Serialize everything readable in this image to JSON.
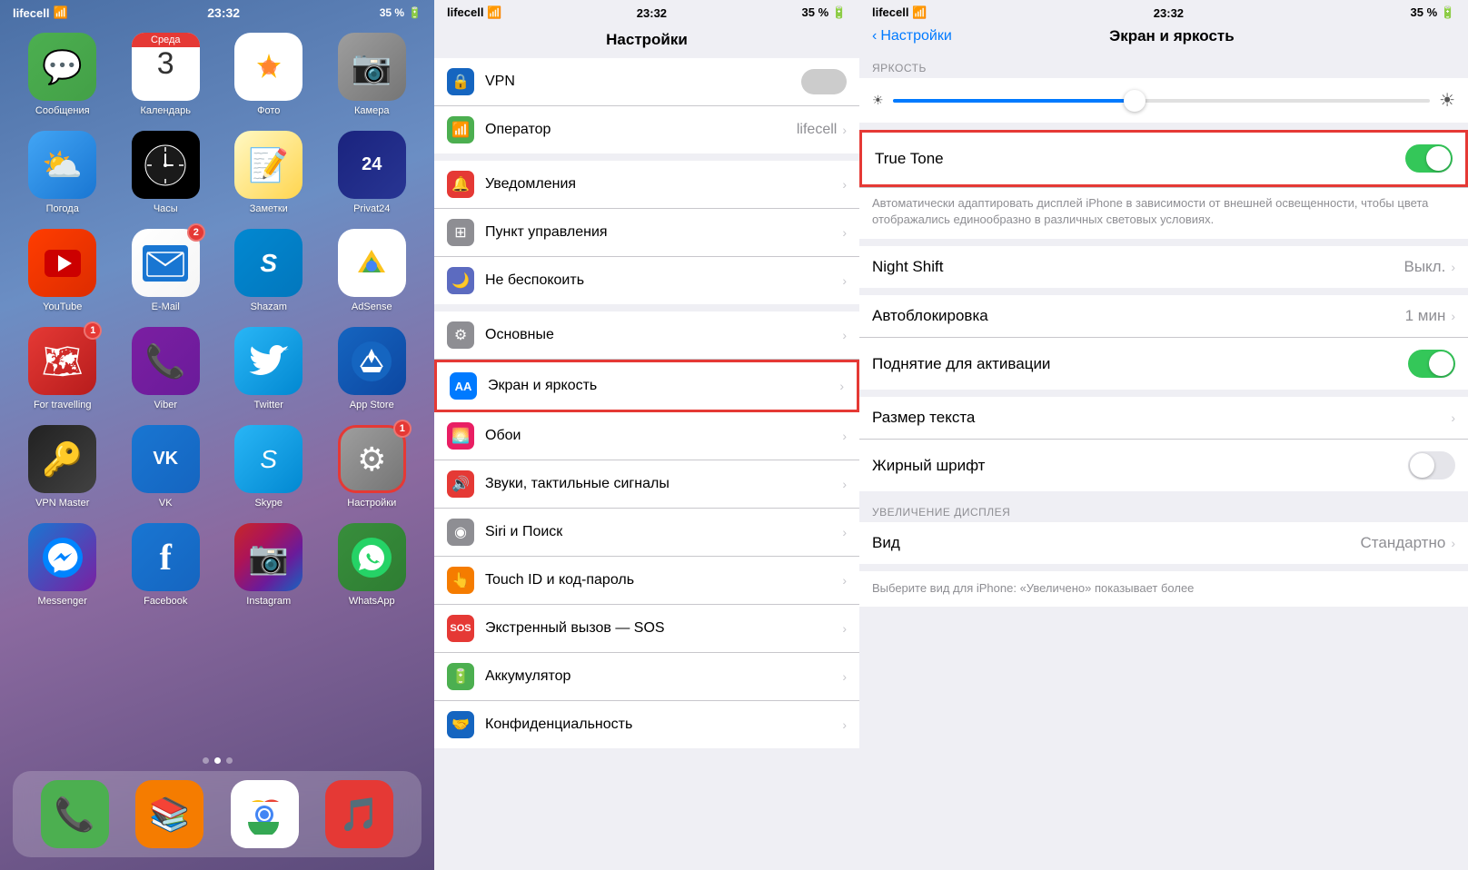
{
  "home": {
    "status": {
      "carrier": "lifecell",
      "time": "23:32",
      "battery": "35 %"
    },
    "apps": [
      {
        "id": "messages",
        "label": "Сообщения",
        "color": "app-messages",
        "icon": "💬",
        "badge": null
      },
      {
        "id": "calendar",
        "label": "Календарь",
        "color": "app-calendar",
        "icon": "calendar",
        "badge": null
      },
      {
        "id": "photos",
        "label": "Фото",
        "color": "app-photos",
        "icon": "photos",
        "badge": null
      },
      {
        "id": "camera",
        "label": "Камера",
        "color": "app-camera",
        "icon": "📷",
        "badge": null
      },
      {
        "id": "weather",
        "label": "Погода",
        "color": "app-weather",
        "icon": "⛅",
        "badge": null
      },
      {
        "id": "clock",
        "label": "Часы",
        "color": "app-clock",
        "icon": "clock",
        "badge": null
      },
      {
        "id": "notes",
        "label": "Заметки",
        "color": "app-notes",
        "icon": "📝",
        "badge": null
      },
      {
        "id": "privat24",
        "label": "Privat24",
        "color": "app-privat",
        "icon": "24",
        "badge": null
      },
      {
        "id": "youtube",
        "label": "YouTube",
        "color": "app-youtube",
        "icon": "▶",
        "badge": null
      },
      {
        "id": "email",
        "label": "E-Mail",
        "color": "app-email",
        "icon": "✉",
        "badge": "2"
      },
      {
        "id": "shazam",
        "label": "Shazam",
        "color": "app-shazam",
        "icon": "S",
        "badge": null
      },
      {
        "id": "adsense",
        "label": "AdSense",
        "color": "app-adsense",
        "icon": "adsense",
        "badge": null
      },
      {
        "id": "travelling",
        "label": "For travelling",
        "color": "app-travelling",
        "icon": "🗺",
        "badge": "1"
      },
      {
        "id": "viber",
        "label": "Viber",
        "color": "app-viber",
        "icon": "📞",
        "badge": null
      },
      {
        "id": "twitter",
        "label": "Twitter",
        "color": "app-twitter",
        "icon": "🐦",
        "badge": null
      },
      {
        "id": "appstore",
        "label": "App Store",
        "color": "app-appstore",
        "icon": "🅐",
        "badge": null
      },
      {
        "id": "vpnmaster",
        "label": "VPN Master",
        "color": "app-vpnmaster",
        "icon": "🔑",
        "badge": null
      },
      {
        "id": "vk",
        "label": "VK",
        "color": "app-vk",
        "icon": "VK",
        "badge": null
      },
      {
        "id": "skype",
        "label": "Skype",
        "color": "app-skype",
        "icon": "S",
        "badge": null
      },
      {
        "id": "settings",
        "label": "Настройки",
        "color": "app-settings",
        "icon": "⚙",
        "badge": "1",
        "highlight": true
      },
      {
        "id": "messenger",
        "label": "Messenger",
        "color": "app-messenger",
        "icon": "💬",
        "badge": null
      },
      {
        "id": "facebook",
        "label": "Facebook",
        "color": "app-facebook",
        "icon": "f",
        "badge": null
      },
      {
        "id": "instagram",
        "label": "Instagram",
        "color": "app-instagram",
        "icon": "📷",
        "badge": null
      },
      {
        "id": "whatsapp",
        "label": "WhatsApp",
        "color": "app-whatsapp",
        "icon": "📱",
        "badge": null
      }
    ],
    "dock": [
      {
        "id": "phone",
        "label": "",
        "icon": "📞",
        "color": "#4caf50"
      },
      {
        "id": "books",
        "label": "",
        "icon": "📚",
        "color": "#f57c00"
      },
      {
        "id": "chrome",
        "label": "",
        "icon": "🌐",
        "color": "#1976d2"
      },
      {
        "id": "music",
        "label": "",
        "icon": "🎵",
        "color": "#e53935"
      }
    ]
  },
  "settings_panel": {
    "status": {
      "carrier": "lifecell",
      "time": "23:32",
      "battery": "35 %"
    },
    "title": "Настройки",
    "rows": [
      {
        "id": "vpn",
        "label": "VPN",
        "icon": "🔒",
        "icon_color": "#1565c0",
        "value": "",
        "has_toggle": true,
        "toggle_on": false
      },
      {
        "id": "operator",
        "label": "Оператор",
        "icon": "📶",
        "icon_color": "#4caf50",
        "value": "lifecell",
        "has_chevron": true
      },
      {
        "id": "notifications",
        "label": "Уведомления",
        "icon": "🔔",
        "icon_color": "#e53935",
        "has_chevron": true
      },
      {
        "id": "control_center",
        "label": "Пункт управления",
        "icon": "⊞",
        "icon_color": "#8e8e93",
        "has_chevron": true
      },
      {
        "id": "do_not_disturb",
        "label": "Не беспокоить",
        "icon": "🌙",
        "icon_color": "#5c6bc0",
        "has_chevron": true
      },
      {
        "id": "general",
        "label": "Основные",
        "icon": "⚙",
        "icon_color": "#8e8e93",
        "has_chevron": true
      },
      {
        "id": "display",
        "label": "Экран и яркость",
        "icon": "AA",
        "icon_color": "#007aff",
        "has_chevron": true,
        "highlight": true
      },
      {
        "id": "wallpaper",
        "label": "Обои",
        "icon": "🌅",
        "icon_color": "#e91e63",
        "has_chevron": true
      },
      {
        "id": "sounds",
        "label": "Звуки, тактильные сигналы",
        "icon": "🔊",
        "icon_color": "#e53935",
        "has_chevron": true
      },
      {
        "id": "siri",
        "label": "Siri и Поиск",
        "icon": "◉",
        "icon_color": "#8e8e93",
        "has_chevron": true
      },
      {
        "id": "touchid",
        "label": "Touch ID и код-пароль",
        "icon": "👆",
        "icon_color": "#f57c00",
        "has_chevron": true
      },
      {
        "id": "sos",
        "label": "Экстренный вызов — SOS",
        "icon": "SOS",
        "icon_color": "#e53935",
        "has_chevron": true
      },
      {
        "id": "battery",
        "label": "Аккумулятор",
        "icon": "🔋",
        "icon_color": "#4caf50",
        "has_chevron": true
      },
      {
        "id": "privacy",
        "label": "Конфиденциальность",
        "icon": "🤝",
        "icon_color": "#1565c0",
        "has_chevron": true
      }
    ]
  },
  "display_panel": {
    "status": {
      "carrier": "lifecell",
      "time": "23:32",
      "battery": "35 %"
    },
    "back_label": "Настройки",
    "title": "Экран и яркость",
    "brightness_section_label": "ЯРКОСТЬ",
    "brightness_value": 45,
    "true_tone": {
      "label": "True Tone",
      "enabled": true,
      "description": "Автоматически адаптировать дисплей iPhone в зависимости от внешней освещенности, чтобы цвета отображались единообразно в различных световых условиях."
    },
    "night_shift": {
      "label": "Night Shift",
      "value": "Выкл."
    },
    "autoblocking": {
      "label": "Автоблокировка",
      "value": "1 мин"
    },
    "raise_to_wake": {
      "label": "Поднятие для активации",
      "enabled": true
    },
    "text_size": {
      "label": "Размер текста"
    },
    "bold_text": {
      "label": "Жирный шрифт",
      "enabled": false
    },
    "zoom_section_label": "УВЕЛИЧЕНИЕ ДИСПЛЕЯ",
    "view": {
      "label": "Вид",
      "value": "Стандартно"
    },
    "zoom_desc": "Выберите вид для iPhone: «Увеличено» показывает более"
  }
}
